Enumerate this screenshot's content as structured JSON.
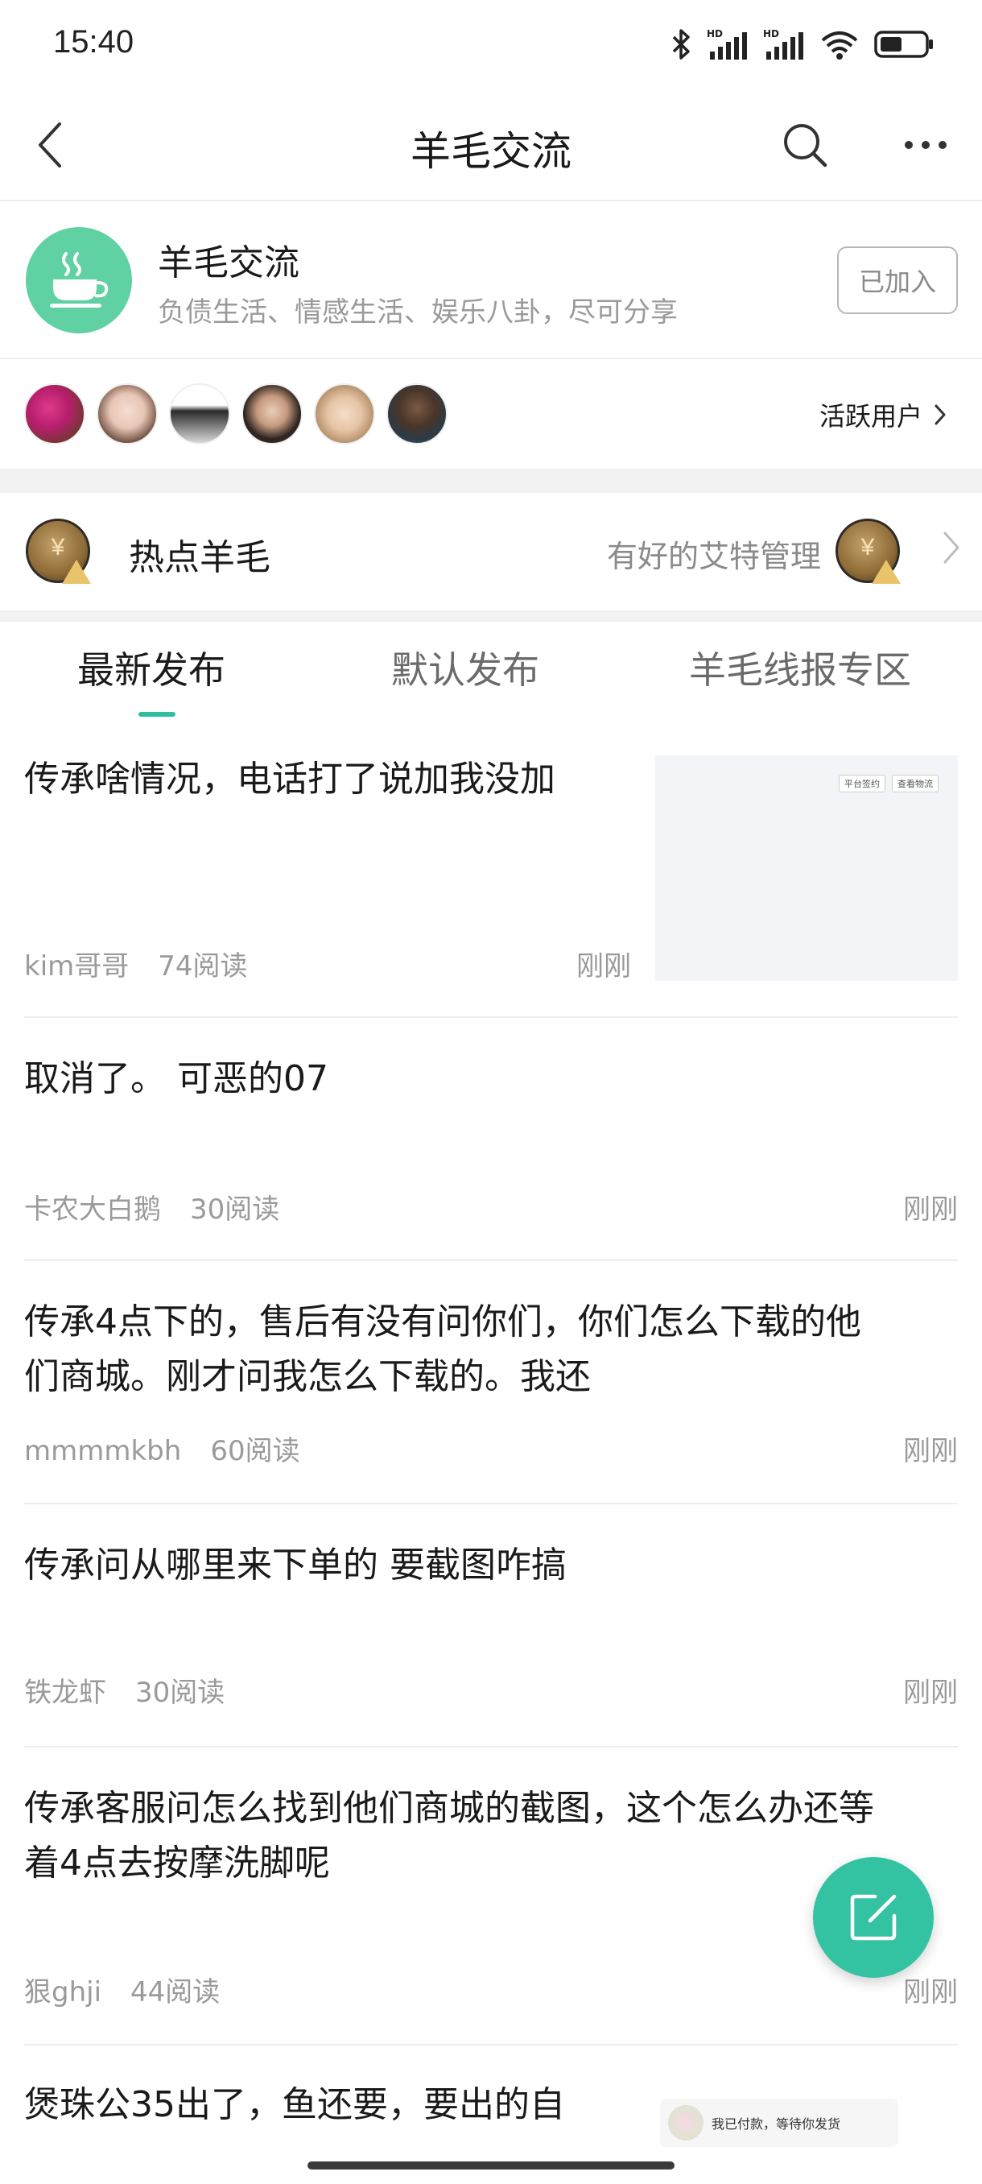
{
  "status_bar": {
    "time": "15:40",
    "icons": [
      "bluetooth-icon",
      "hd-signal-icon",
      "hd-signal-icon",
      "wifi-icon",
      "battery-icon"
    ]
  },
  "header": {
    "title": "羊毛交流",
    "icons": [
      "back-icon",
      "search-icon",
      "more-icon"
    ]
  },
  "group": {
    "name": "羊毛交流",
    "description": "负债生活、情感生活、娱乐八卦，尽可分享",
    "joined_label": "已加入",
    "avatar_icon": "teacup-icon",
    "accent_color": "#5fd1a3"
  },
  "active_users": {
    "label": "活跃用户",
    "avatar_count": 6
  },
  "hot": {
    "title": "热点羊毛",
    "subtitle": "有好的艾特管理"
  },
  "tabs": [
    {
      "label": "最新发布",
      "active": true
    },
    {
      "label": "默认发布",
      "active": false
    },
    {
      "label": "羊毛线报专区",
      "active": false
    }
  ],
  "posts": [
    {
      "title": "传承啥情况，电话打了说加我没加",
      "author": "kim哥哥",
      "reads": "74阅读",
      "time": "刚刚",
      "thumb_buttons": [
        "平台签约",
        "查看物流"
      ]
    },
    {
      "title": "取消了。 可恶的07",
      "author": "卡农大白鹅",
      "reads": "30阅读",
      "time": "刚刚"
    },
    {
      "title_lines": [
        "传承4点下的，售后有没有问你们，你们怎么下载的他",
        "们商城。刚才问我怎么下载的。我还"
      ],
      "author": "mmmmkbh",
      "reads": "60阅读",
      "time": "刚刚"
    },
    {
      "title": "传承问从哪里来下单的 要截图咋搞",
      "author": "铁龙虾",
      "reads": "30阅读",
      "time": "刚刚"
    },
    {
      "title_lines": [
        "传承客服问怎么找到他们商城的截图，这个怎么办还等",
        "着4点去按摩洗脚呢"
      ],
      "author": "狠ghji",
      "reads": "44阅读",
      "time": "刚刚"
    },
    {
      "title": "煲珠公35出了，鱼还要，要出的自"
    }
  ],
  "fab": {
    "icon": "compose-icon",
    "color": "#33c3a2"
  },
  "notification": {
    "text": "我已付款，等待你发货"
  }
}
